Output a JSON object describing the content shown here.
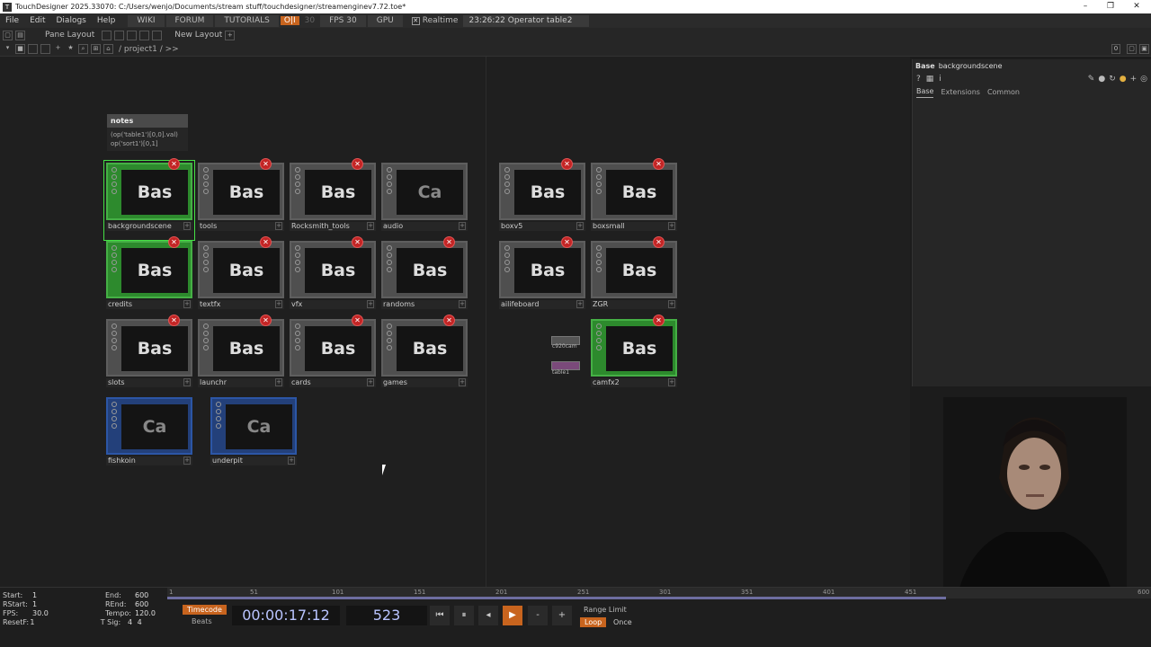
{
  "window": {
    "title": "TouchDesigner 2025.33070: C:/Users/wenjo/Documents/stream stuff/touchdesigner/streamenginev7.72.toe*",
    "icon": "td-logo-icon"
  },
  "menu": {
    "items": [
      "File",
      "Edit",
      "Dialogs",
      "Help"
    ],
    "wiki": "WIKI",
    "forum": "FORUM",
    "tutorials": "TUTORIALS",
    "oi": "O|I",
    "fps_box": "30",
    "fps": "FPS  30",
    "gpu": "GPU",
    "realtime": "Realtime",
    "message": "23:26:22 Operator table2 deleted."
  },
  "toolbar2": {
    "pane_layout": "Pane Layout",
    "new_layout": "New Layout"
  },
  "toolbar3": {
    "path": "/ project1 / >>",
    "count": "0"
  },
  "notes": {
    "title": "notes",
    "line1": "(op('table1')[0,0].val)",
    "line2": "op('sort1')[0,1]"
  },
  "operators": [
    {
      "label": "backgroundscene",
      "preview": "Bas",
      "style": "green",
      "selected": true
    },
    {
      "label": "tools",
      "preview": "Bas",
      "style": "grey"
    },
    {
      "label": "Rocksmith_tools",
      "preview": "Bas",
      "style": "grey"
    },
    {
      "label": "audio",
      "preview": "Ca",
      "style": "grey",
      "cam": true,
      "noX": true
    },
    {
      "label": "boxv5",
      "preview": "Bas",
      "style": "grey"
    },
    {
      "label": "boxsmall",
      "preview": "Bas",
      "style": "grey"
    },
    {
      "label": "credits",
      "preview": "Bas",
      "style": "green"
    },
    {
      "label": "textfx",
      "preview": "Bas",
      "style": "grey"
    },
    {
      "label": "vfx",
      "preview": "Bas",
      "style": "grey"
    },
    {
      "label": "randoms",
      "preview": "Bas",
      "style": "grey"
    },
    {
      "label": "ailifeboard",
      "preview": "Bas",
      "style": "grey"
    },
    {
      "label": "ZGR",
      "preview": "Bas",
      "style": "grey"
    },
    {
      "label": "slots",
      "preview": "Bas",
      "style": "grey"
    },
    {
      "label": "launchr",
      "preview": "Bas",
      "style": "grey"
    },
    {
      "label": "cards",
      "preview": "Bas",
      "style": "grey"
    },
    {
      "label": "games",
      "preview": "Bas",
      "style": "grey"
    },
    {
      "label": "camfx2",
      "preview": "Bas",
      "style": "green"
    },
    {
      "label": "fishkoin",
      "preview": "Ca",
      "style": "blue",
      "cam": true,
      "noX": true
    },
    {
      "label": "underpit",
      "preview": "Ca",
      "style": "blue",
      "cam": true,
      "noX": true
    }
  ],
  "minis": {
    "a": "c920cam",
    "b": "table1"
  },
  "params": {
    "type": "Base",
    "name": "backgroundscene",
    "tabs": [
      "Base",
      "Extensions",
      "Common"
    ]
  },
  "timeline": {
    "start": "1",
    "end": "600",
    "rstart": "1",
    "rend": "600",
    "fps": "30.0",
    "tempo": "120.0",
    "resetf": "1",
    "tsig_a": "4",
    "tsig_b": "4",
    "k_start": "Start:",
    "k_end": "End:",
    "k_rstart": "RStart:",
    "k_rend": "REnd:",
    "k_fps": "FPS:",
    "k_tempo": "Tempo:",
    "k_resetf": "ResetF:",
    "k_tsig": "T Sig:",
    "timecode_label": "Timecode",
    "beats_label": "Beats",
    "timecode": "00:00:17:12",
    "frame": "523",
    "range_limit": "Range Limit",
    "loop": "Loop",
    "once": "Once",
    "ticks": [
      "1",
      "51",
      "101",
      "151",
      "201",
      "251",
      "301",
      "351",
      "401",
      "451",
      "600"
    ]
  }
}
